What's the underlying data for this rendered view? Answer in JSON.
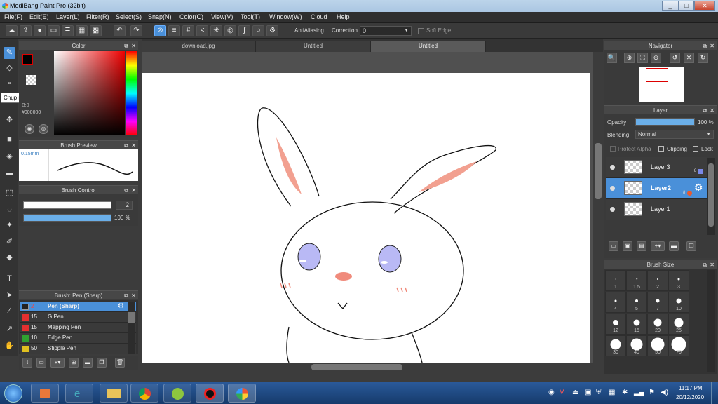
{
  "window": {
    "title": "MediBang Paint Pro (32bit)",
    "min": "_",
    "max": "□",
    "close": "✕"
  },
  "menu": [
    "File(F)",
    "Edit(E)",
    "Layer(L)",
    "Filter(R)",
    "Select(S)",
    "Snap(N)",
    "Color(C)",
    "View(V)",
    "Tool(T)",
    "Window(W)",
    "Cloud",
    "Help"
  ],
  "toolbar": {
    "antialiasing_label": "AntiAliasing",
    "correction_label": "Correction",
    "correction_value": "0",
    "soft_edge_label": "Soft Edge"
  },
  "tooltip": "Chụp màn hình",
  "color_panel": {
    "title": "Color",
    "hex": "#000000",
    "rgb_label": "B:0",
    "fg_color": "#000000",
    "accent": "#cc0000"
  },
  "brush_preview": {
    "title": "Brush Preview",
    "size": "0.15mm"
  },
  "brush_control": {
    "title": "Brush Control",
    "size_value": "2",
    "opacity_value": "100 %"
  },
  "brush_list": {
    "title": "Brush: Pen (Sharp)",
    "items": [
      {
        "size": "2",
        "name": "Pen (Sharp)",
        "color": "#222222",
        "selected": true
      },
      {
        "size": "15",
        "name": "G Pen",
        "color": "#e53030"
      },
      {
        "size": "15",
        "name": "Mapping Pen",
        "color": "#e53030"
      },
      {
        "size": "10",
        "name": "Edge Pen",
        "color": "#30a030"
      },
      {
        "size": "50",
        "name": "Stipple Pen",
        "color": "#e0c020"
      }
    ]
  },
  "tabs": [
    {
      "label": "download.jpg"
    },
    {
      "label": "Untitled"
    },
    {
      "label": "Untitled",
      "active": true
    }
  ],
  "navigator": {
    "title": "Navigator"
  },
  "layer_panel": {
    "title": "Layer",
    "opacity_label": "Opacity",
    "opacity_value": "100 %",
    "blending_label": "Blending",
    "blending_value": "Normal",
    "protect_alpha": "Protect Alpha",
    "clipping": "Clipping",
    "lock": "Lock",
    "layers": [
      {
        "name": "Layer3",
        "bits": "8"
      },
      {
        "name": "Layer2",
        "bits": "8",
        "selected": true
      },
      {
        "name": "Layer1"
      }
    ]
  },
  "brush_size": {
    "title": "Brush Size",
    "sizes": [
      "1",
      "1.5",
      "2",
      "3",
      "4",
      "5",
      "7",
      "10",
      "12",
      "15",
      "20",
      "25",
      "30",
      "40",
      "50",
      "70"
    ]
  },
  "taskbar": {
    "time": "11:17 PM",
    "date": "20/12/2020"
  }
}
